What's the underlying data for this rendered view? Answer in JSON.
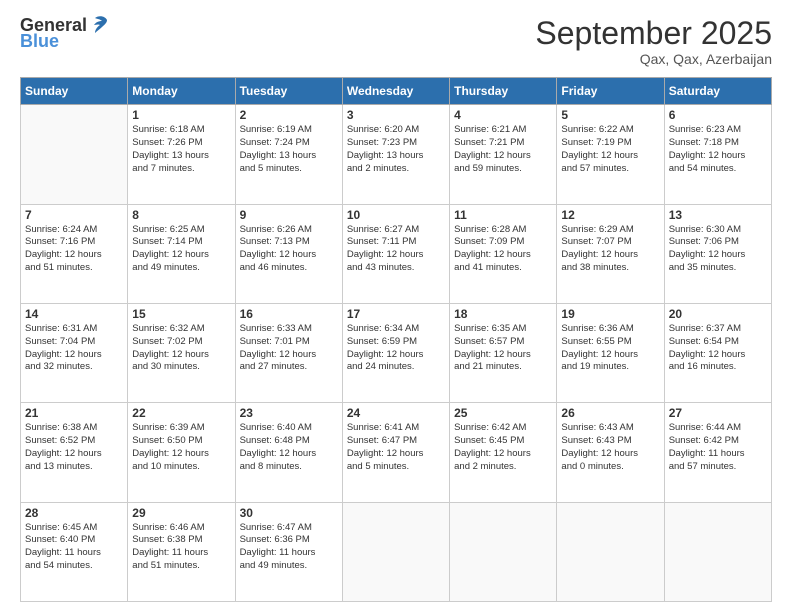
{
  "logo": {
    "general": "General",
    "blue": "Blue"
  },
  "header": {
    "month": "September 2025",
    "location": "Qax, Qax, Azerbaijan"
  },
  "days": [
    "Sunday",
    "Monday",
    "Tuesday",
    "Wednesday",
    "Thursday",
    "Friday",
    "Saturday"
  ],
  "weeks": [
    [
      {
        "day": "",
        "lines": []
      },
      {
        "day": "1",
        "lines": [
          "Sunrise: 6:18 AM",
          "Sunset: 7:26 PM",
          "Daylight: 13 hours",
          "and 7 minutes."
        ]
      },
      {
        "day": "2",
        "lines": [
          "Sunrise: 6:19 AM",
          "Sunset: 7:24 PM",
          "Daylight: 13 hours",
          "and 5 minutes."
        ]
      },
      {
        "day": "3",
        "lines": [
          "Sunrise: 6:20 AM",
          "Sunset: 7:23 PM",
          "Daylight: 13 hours",
          "and 2 minutes."
        ]
      },
      {
        "day": "4",
        "lines": [
          "Sunrise: 6:21 AM",
          "Sunset: 7:21 PM",
          "Daylight: 12 hours",
          "and 59 minutes."
        ]
      },
      {
        "day": "5",
        "lines": [
          "Sunrise: 6:22 AM",
          "Sunset: 7:19 PM",
          "Daylight: 12 hours",
          "and 57 minutes."
        ]
      },
      {
        "day": "6",
        "lines": [
          "Sunrise: 6:23 AM",
          "Sunset: 7:18 PM",
          "Daylight: 12 hours",
          "and 54 minutes."
        ]
      }
    ],
    [
      {
        "day": "7",
        "lines": [
          "Sunrise: 6:24 AM",
          "Sunset: 7:16 PM",
          "Daylight: 12 hours",
          "and 51 minutes."
        ]
      },
      {
        "day": "8",
        "lines": [
          "Sunrise: 6:25 AM",
          "Sunset: 7:14 PM",
          "Daylight: 12 hours",
          "and 49 minutes."
        ]
      },
      {
        "day": "9",
        "lines": [
          "Sunrise: 6:26 AM",
          "Sunset: 7:13 PM",
          "Daylight: 12 hours",
          "and 46 minutes."
        ]
      },
      {
        "day": "10",
        "lines": [
          "Sunrise: 6:27 AM",
          "Sunset: 7:11 PM",
          "Daylight: 12 hours",
          "and 43 minutes."
        ]
      },
      {
        "day": "11",
        "lines": [
          "Sunrise: 6:28 AM",
          "Sunset: 7:09 PM",
          "Daylight: 12 hours",
          "and 41 minutes."
        ]
      },
      {
        "day": "12",
        "lines": [
          "Sunrise: 6:29 AM",
          "Sunset: 7:07 PM",
          "Daylight: 12 hours",
          "and 38 minutes."
        ]
      },
      {
        "day": "13",
        "lines": [
          "Sunrise: 6:30 AM",
          "Sunset: 7:06 PM",
          "Daylight: 12 hours",
          "and 35 minutes."
        ]
      }
    ],
    [
      {
        "day": "14",
        "lines": [
          "Sunrise: 6:31 AM",
          "Sunset: 7:04 PM",
          "Daylight: 12 hours",
          "and 32 minutes."
        ]
      },
      {
        "day": "15",
        "lines": [
          "Sunrise: 6:32 AM",
          "Sunset: 7:02 PM",
          "Daylight: 12 hours",
          "and 30 minutes."
        ]
      },
      {
        "day": "16",
        "lines": [
          "Sunrise: 6:33 AM",
          "Sunset: 7:01 PM",
          "Daylight: 12 hours",
          "and 27 minutes."
        ]
      },
      {
        "day": "17",
        "lines": [
          "Sunrise: 6:34 AM",
          "Sunset: 6:59 PM",
          "Daylight: 12 hours",
          "and 24 minutes."
        ]
      },
      {
        "day": "18",
        "lines": [
          "Sunrise: 6:35 AM",
          "Sunset: 6:57 PM",
          "Daylight: 12 hours",
          "and 21 minutes."
        ]
      },
      {
        "day": "19",
        "lines": [
          "Sunrise: 6:36 AM",
          "Sunset: 6:55 PM",
          "Daylight: 12 hours",
          "and 19 minutes."
        ]
      },
      {
        "day": "20",
        "lines": [
          "Sunrise: 6:37 AM",
          "Sunset: 6:54 PM",
          "Daylight: 12 hours",
          "and 16 minutes."
        ]
      }
    ],
    [
      {
        "day": "21",
        "lines": [
          "Sunrise: 6:38 AM",
          "Sunset: 6:52 PM",
          "Daylight: 12 hours",
          "and 13 minutes."
        ]
      },
      {
        "day": "22",
        "lines": [
          "Sunrise: 6:39 AM",
          "Sunset: 6:50 PM",
          "Daylight: 12 hours",
          "and 10 minutes."
        ]
      },
      {
        "day": "23",
        "lines": [
          "Sunrise: 6:40 AM",
          "Sunset: 6:48 PM",
          "Daylight: 12 hours",
          "and 8 minutes."
        ]
      },
      {
        "day": "24",
        "lines": [
          "Sunrise: 6:41 AM",
          "Sunset: 6:47 PM",
          "Daylight: 12 hours",
          "and 5 minutes."
        ]
      },
      {
        "day": "25",
        "lines": [
          "Sunrise: 6:42 AM",
          "Sunset: 6:45 PM",
          "Daylight: 12 hours",
          "and 2 minutes."
        ]
      },
      {
        "day": "26",
        "lines": [
          "Sunrise: 6:43 AM",
          "Sunset: 6:43 PM",
          "Daylight: 12 hours",
          "and 0 minutes."
        ]
      },
      {
        "day": "27",
        "lines": [
          "Sunrise: 6:44 AM",
          "Sunset: 6:42 PM",
          "Daylight: 11 hours",
          "and 57 minutes."
        ]
      }
    ],
    [
      {
        "day": "28",
        "lines": [
          "Sunrise: 6:45 AM",
          "Sunset: 6:40 PM",
          "Daylight: 11 hours",
          "and 54 minutes."
        ]
      },
      {
        "day": "29",
        "lines": [
          "Sunrise: 6:46 AM",
          "Sunset: 6:38 PM",
          "Daylight: 11 hours",
          "and 51 minutes."
        ]
      },
      {
        "day": "30",
        "lines": [
          "Sunrise: 6:47 AM",
          "Sunset: 6:36 PM",
          "Daylight: 11 hours",
          "and 49 minutes."
        ]
      },
      {
        "day": "",
        "lines": []
      },
      {
        "day": "",
        "lines": []
      },
      {
        "day": "",
        "lines": []
      },
      {
        "day": "",
        "lines": []
      }
    ]
  ]
}
